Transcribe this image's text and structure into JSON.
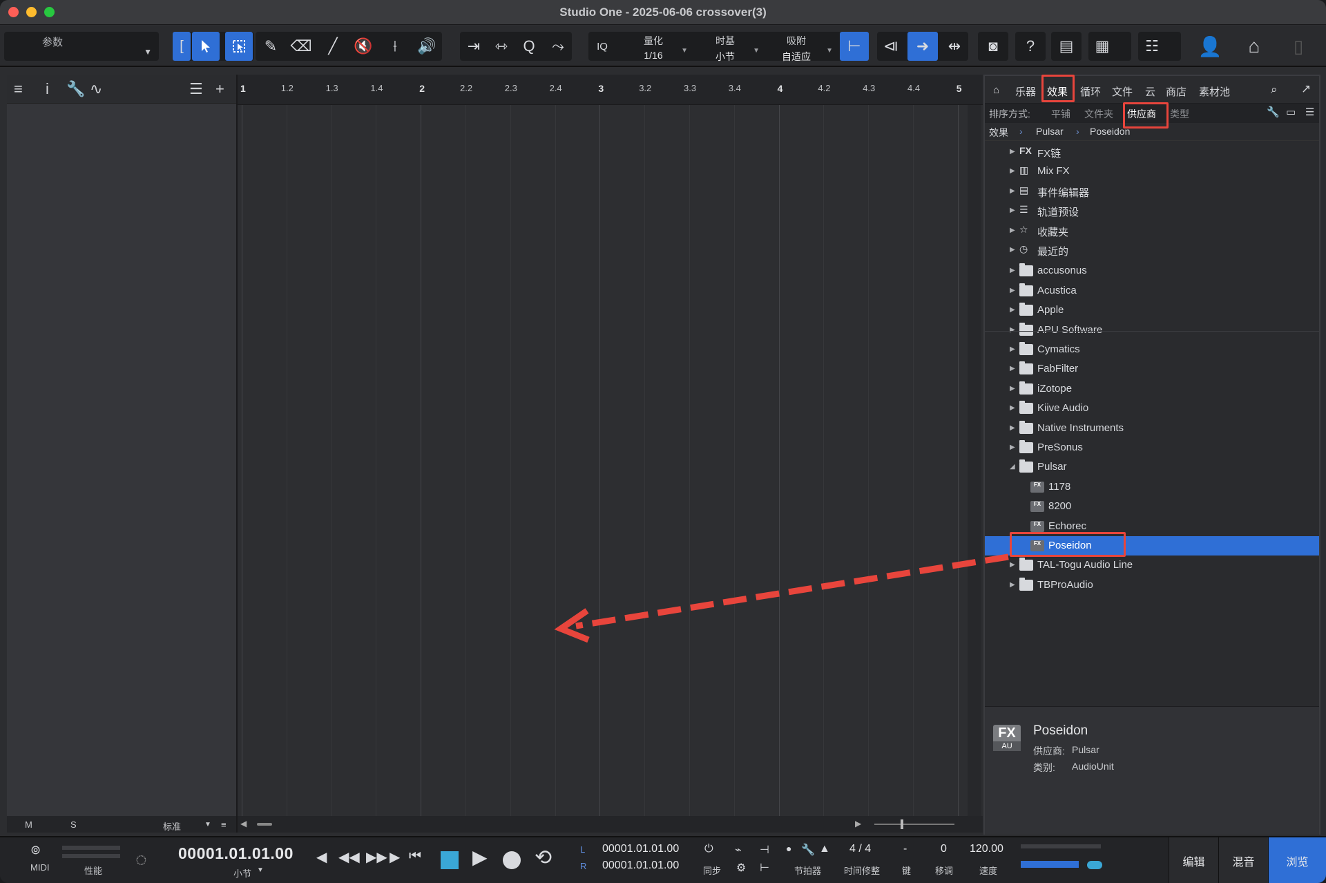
{
  "window": {
    "title": "Studio One - 2025-06-06 crossover(3)"
  },
  "toolbar": {
    "parameter_label": "参数",
    "quantize": {
      "label": "量化",
      "value": "1/16"
    },
    "timebase": {
      "label": "时基",
      "value": "小节"
    },
    "snap": {
      "label": "吸附",
      "value": "自适应"
    },
    "iq_label": "IQ",
    "help_label": "?"
  },
  "ruler": {
    "ticks": [
      "1",
      "1.2",
      "1.3",
      "1.4",
      "2",
      "2.2",
      "2.3",
      "2.4",
      "3",
      "3.2",
      "3.3",
      "3.4",
      "4",
      "4.2",
      "4.3",
      "4.4",
      "5"
    ]
  },
  "inspector_footer": {
    "m": "M",
    "s": "S",
    "mode": "标准"
  },
  "browser": {
    "tabs": [
      "乐器",
      "效果",
      "循环",
      "文件",
      "云",
      "商店",
      "素材池"
    ],
    "active_tab": "效果",
    "sort": {
      "label": "排序方式:",
      "options": [
        "平铺",
        "文件夹",
        "供应商",
        "类型"
      ],
      "active": "供应商"
    },
    "breadcrumb": [
      "效果",
      "Pulsar",
      "Poseidon"
    ],
    "tree": [
      {
        "label": "FX链",
        "icon": "fx-chain-icon"
      },
      {
        "label": "Mix FX",
        "icon": "mixfx-icon"
      },
      {
        "label": "事件编辑器",
        "icon": "event-editor-icon"
      },
      {
        "label": "轨道预设",
        "icon": "track-preset-icon"
      },
      {
        "label": "收藏夹",
        "icon": "star-icon"
      },
      {
        "label": "最近的",
        "icon": "clock-icon"
      }
    ],
    "vendors": [
      "accusonus",
      "Acustica",
      "Apple",
      "APU Software",
      "Cymatics",
      "FabFilter",
      "iZotope",
      "Kiive Audio",
      "Native Instruments",
      "PreSonus",
      "Pulsar"
    ],
    "pulsar_children": [
      "1178",
      "8200",
      "Echorec",
      "Poseidon"
    ],
    "vendors_after": [
      "TAL-Togu Audio Line",
      "TBProAudio"
    ],
    "selected": "Poseidon",
    "info": {
      "fx": "FX",
      "au": "AU",
      "name": "Poseidon",
      "vendor_label": "供应商:",
      "vendor_value": "Pulsar",
      "category_label": "类别:",
      "category_value": "AudioUnit"
    }
  },
  "transport": {
    "midi_label": "MIDI",
    "perf_label": "性能",
    "position": "00001.01.01.00",
    "position_unit": "小节",
    "loop_l_label": "L",
    "loop_r_label": "R",
    "loop_l": "00001.01.01.00",
    "loop_r": "00001.01.01.00",
    "sync_label": "同步",
    "metronome_label": "节拍器",
    "signature": "4 / 4",
    "signature_label": "时间修整",
    "key": "-",
    "key_label": "键",
    "transpose": "0",
    "transpose_label": "移调",
    "tempo": "120.00",
    "tempo_label": "速度",
    "views": [
      "编辑",
      "混音",
      "浏览"
    ],
    "active_view": "浏览"
  },
  "colors": {
    "accent": "#2f6fd6",
    "highlight": "#e8453c"
  }
}
